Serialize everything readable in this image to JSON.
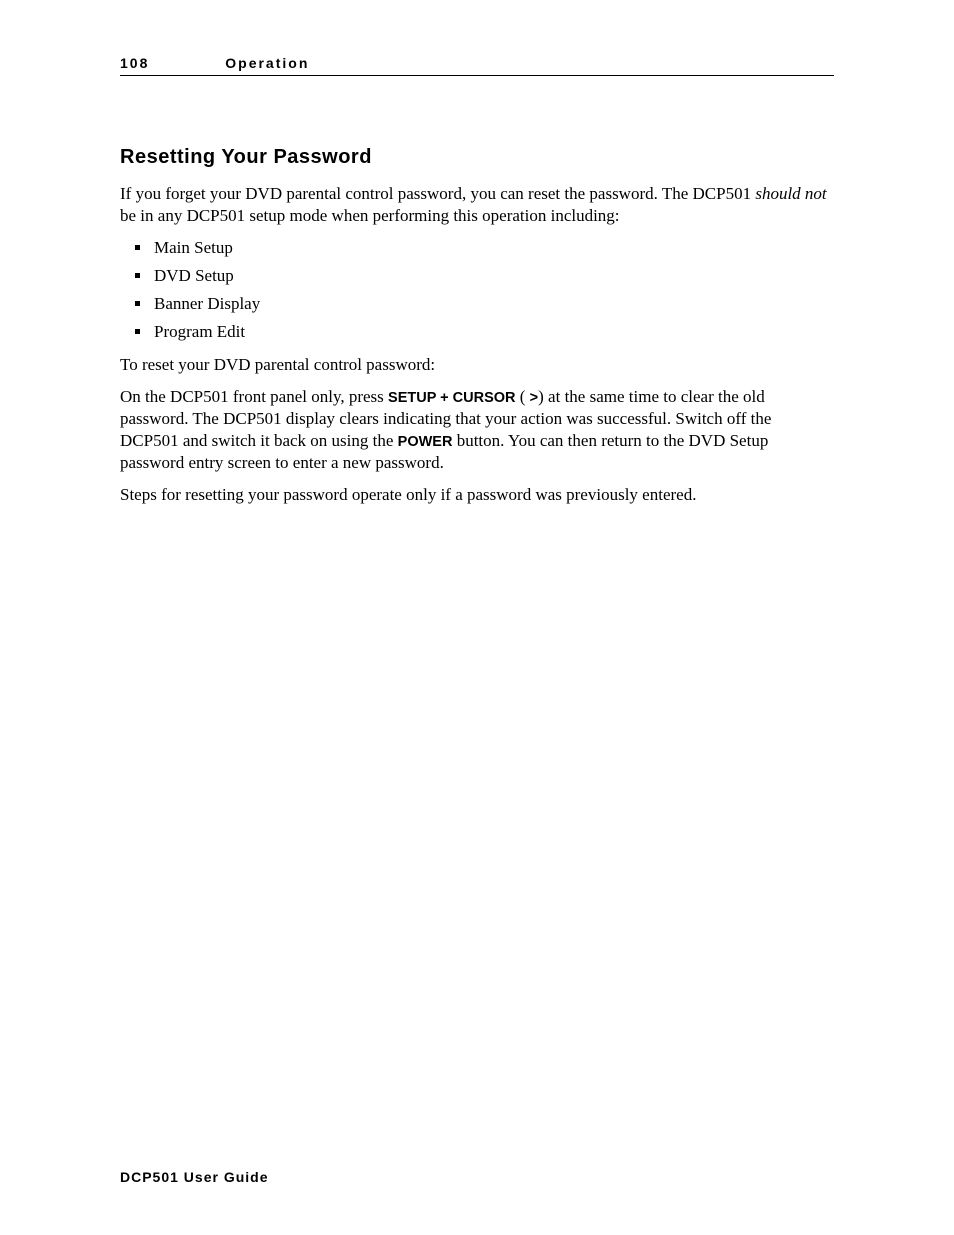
{
  "header": {
    "page_number": "108",
    "section": "Operation"
  },
  "title": "Resetting Your Password",
  "intro_part1": "If you forget your DVD parental control password, you can reset the password. The DCP501 ",
  "intro_italic": "should not",
  "intro_part2": " be in any DCP501 setup mode when performing this operation including:",
  "bullets": [
    "Main Setup",
    "DVD Setup",
    "Banner Display",
    "Program Edit"
  ],
  "line_reset": "To reset your DVD parental control password:",
  "para2_a": "On the DCP501 front panel only, press ",
  "para2_kbd1": "SETUP + CURSOR",
  "para2_b": " ( ",
  "para2_kbd2": ">",
  "para2_c": ") at the same time to clear the old password. The DCP501 display clears indicating that your action was successful. Switch off the DCP501 and switch it back on using the ",
  "para2_kbd3": "POWER",
  "para2_d": " button. You can then return to the DVD Setup password entry screen to enter a new password.",
  "para3": "Steps for resetting your password operate only if a password was previously entered.",
  "footer": "DCP501 User Guide"
}
